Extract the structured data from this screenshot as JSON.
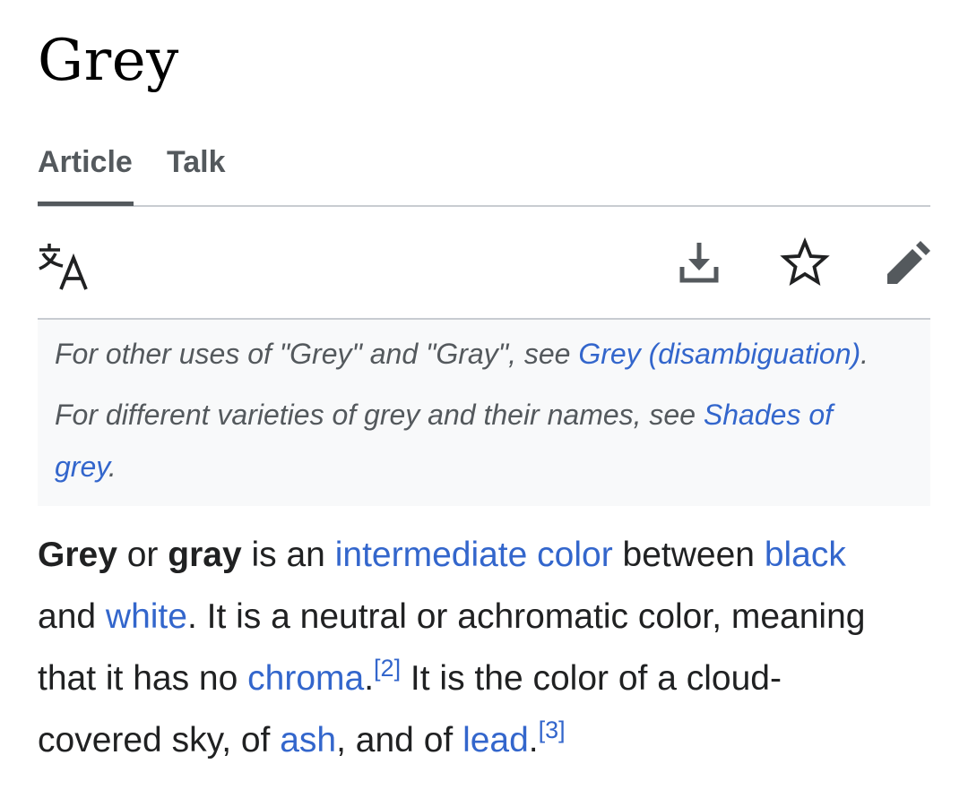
{
  "page": {
    "title": "Grey"
  },
  "tabs": {
    "article": "Article",
    "talk": "Talk"
  },
  "toolbar": {
    "language_icon": "translate-icon",
    "download_icon": "download-icon",
    "watch_icon": "star-icon",
    "edit_icon": "pencil-icon"
  },
  "hatnote": {
    "line1_text": "For other uses of \"Grey\" and \"Gray\", see ",
    "line1_link": "Grey (disambiguation)",
    "line1_end": ".",
    "line2_text": "For different varieties of grey and their names, see ",
    "line2_link_part1": "Shades of",
    "line2_link_part2": "grey",
    "line2_end": "."
  },
  "body": {
    "bold1": "Grey",
    "t1": " or ",
    "bold2": "gray",
    "t2": " is an ",
    "link_intermediate": "intermediate color",
    "t3": " between ",
    "link_black": "black",
    "t4": "and ",
    "link_white": "white",
    "t5": ". It is a neutral or achromatic color, meaning",
    "t6": "that it has no ",
    "link_chroma": "chroma",
    "t7": ".",
    "ref2": "[2]",
    "t8": " It is the color of a cloud-",
    "t9": "covered sky, of ",
    "link_ash": "ash",
    "t10": ", and of ",
    "link_lead": "lead",
    "t11": ".",
    "ref3": "[3]"
  },
  "colors": {
    "link": "#3366cc",
    "text": "#202122",
    "muted": "#54595d",
    "hatnote_bg": "#f8f9fa",
    "border": "#c8ccd1"
  }
}
